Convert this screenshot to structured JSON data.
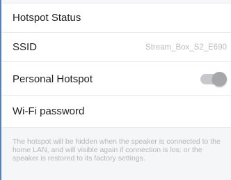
{
  "settings": {
    "hotspot_status_label": "Hotspot Status",
    "ssid_label": "SSID",
    "ssid_value": "Stream_Box_S2_E690",
    "personal_hotspot_label": "Personal Hotspot",
    "personal_hotspot_enabled": false,
    "wifi_password_label": "Wi-Fi password"
  },
  "note": {
    "text": "The hotspot will be hidden when the speaker is connected to the home LAN, and will visible again if connection is los: or the speaker is restored to its factory settings."
  },
  "colors": {
    "text_primary": "#1f1f1f",
    "text_secondary": "#b9bcc0",
    "toggle_track": "#c7c8cb",
    "toggle_knob": "#a5a7aa",
    "note_background": "#f5f6f8",
    "edge_accent": "#5b7fb8"
  }
}
